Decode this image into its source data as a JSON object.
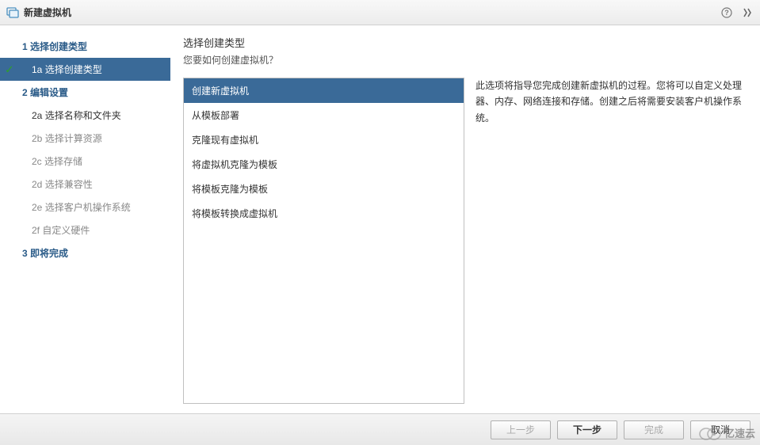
{
  "titlebar": {
    "title": "新建虚拟机"
  },
  "sidebar": {
    "steps": [
      {
        "num": "1",
        "label": "选择创建类型"
      },
      {
        "num": "2",
        "label": "编辑设置"
      },
      {
        "num": "3",
        "label": "即将完成"
      }
    ],
    "substeps1": [
      {
        "num": "1a",
        "label": "选择创建类型",
        "active": true
      }
    ],
    "substeps2": [
      {
        "num": "2a",
        "label": "选择名称和文件夹"
      },
      {
        "num": "2b",
        "label": "选择计算资源"
      },
      {
        "num": "2c",
        "label": "选择存储"
      },
      {
        "num": "2d",
        "label": "选择兼容性"
      },
      {
        "num": "2e",
        "label": "选择客户机操作系统"
      },
      {
        "num": "2f",
        "label": "自定义硬件"
      }
    ]
  },
  "main": {
    "title": "选择创建类型",
    "subtitle": "您要如何创建虚拟机？",
    "options": [
      "创建新虚拟机",
      "从模板部署",
      "克隆现有虚拟机",
      "将虚拟机克隆为模板",
      "将模板克隆为模板",
      "将模板转换成虚拟机"
    ],
    "description": "此选项将指导您完成创建新虚拟机的过程。您将可以自定义处理器、内存、网络连接和存储。创建之后将需要安装客户机操作系统。"
  },
  "footer": {
    "back": "上一步",
    "next": "下一步",
    "finish": "完成",
    "cancel": "取消"
  },
  "watermark": {
    "text": "亿速云"
  }
}
